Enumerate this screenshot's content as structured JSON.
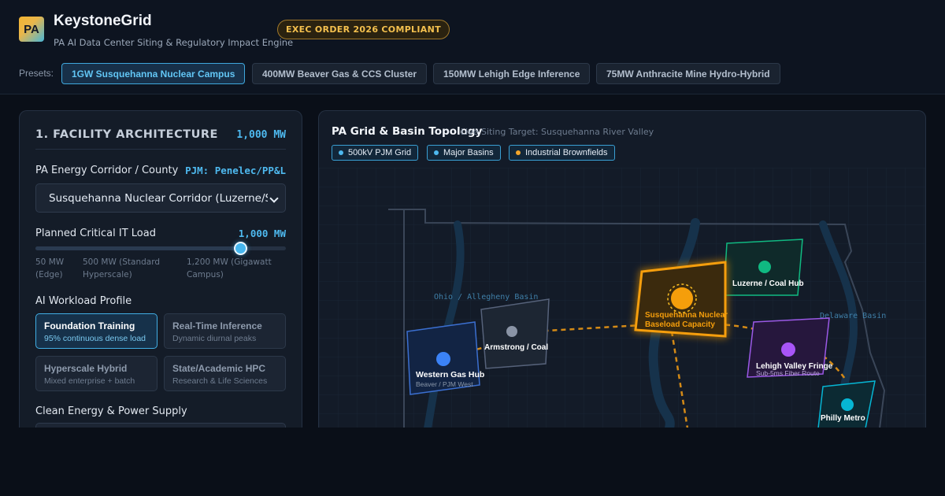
{
  "header": {
    "logo_text": "PA",
    "title": "KeystoneGrid",
    "subtitle": "PA AI Data Center Siting & Regulatory Impact Engine",
    "badge": "EXEC ORDER 2026 COMPLIANT"
  },
  "presets": {
    "label": "Presets:",
    "items": [
      {
        "label": "1GW Susquehanna Nuclear Campus",
        "active": true
      },
      {
        "label": "400MW Beaver Gas & CCS Cluster",
        "active": false
      },
      {
        "label": "150MW Lehigh Edge Inference",
        "active": false
      },
      {
        "label": "75MW Anthracite Mine Hydro-Hybrid",
        "active": false
      }
    ]
  },
  "facility": {
    "title": "1. FACILITY ARCHITECTURE",
    "mw_display": "1,000 MW",
    "corridor_label": "PA Energy Corridor / County",
    "corridor_utility": "PJM: Penelec/PP&L",
    "corridor_selected": "Susquehanna Nuclear Corridor (Luzerne/Salem Twp)",
    "load_label": "Planned Critical IT Load",
    "load_value": "1,000 MW",
    "load_fraction": 0.82,
    "load_ticks": [
      "50 MW (Edge)",
      "500 MW (Standard Hyperscale)",
      "1,200 MW (Gigawatt Campus)"
    ],
    "workload_label": "AI Workload Profile",
    "workloads": [
      {
        "title": "Foundation Training",
        "sub": "95% continuous dense load",
        "active": true
      },
      {
        "title": "Real-Time Inference",
        "sub": "Dynamic diurnal peaks",
        "active": false
      },
      {
        "title": "Hyperscale Hybrid",
        "sub": "Mixed enterprise + batch",
        "active": false
      },
      {
        "title": "State/Academic HPC",
        "sub": "Research & Life Sciences",
        "active": false
      }
    ],
    "power_label": "Clean Energy & Power Supply"
  },
  "map": {
    "title": "PA Grid & Basin Topology",
    "target": "Live Siting Target: Susquehanna River Valley",
    "legend": [
      {
        "label": "500kV PJM Grid",
        "color": "#4eb9ef"
      },
      {
        "label": "Major Basins",
        "color": "#4eb9ef"
      },
      {
        "label": "Industrial Brownfields",
        "color": "#f4a52a"
      }
    ],
    "basins": [
      "Ohio / Allegheny Basin",
      "Delaware Basin"
    ],
    "sites": [
      {
        "name": "Western Gas Hub",
        "sub": "Beaver / PJM West",
        "color": "#3b82f6"
      },
      {
        "name": "Armstrong / Coal",
        "sub": "",
        "color": "#8a94a6"
      },
      {
        "name": "Susquehanna Nuclear",
        "sub": "Baseload Capacity",
        "color": "#f59e0b"
      },
      {
        "name": "Luzerne / Coal Hub",
        "sub": "",
        "color": "#10b981"
      },
      {
        "name": "Lehigh Valley Fringe",
        "sub": "Sub-5ms Fiber Route",
        "color": "#a855f7"
      },
      {
        "name": "Philly Metro",
        "sub": "",
        "color": "#06b6d4"
      }
    ]
  }
}
